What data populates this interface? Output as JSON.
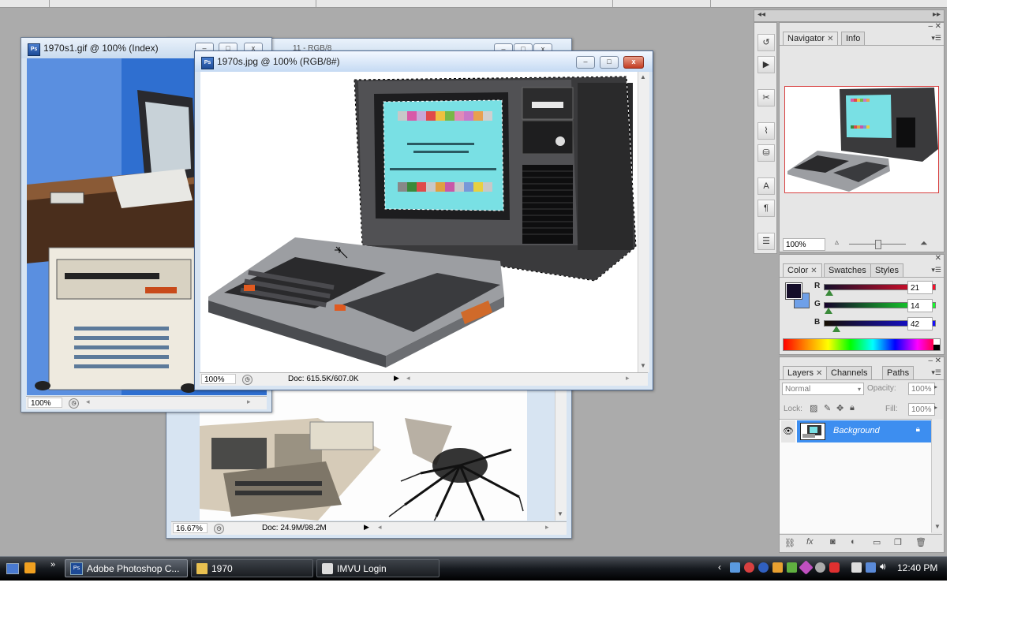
{
  "documents": {
    "back": {
      "title": "11 - RGB/8",
      "zoom": "16.67%",
      "doc_info": "Doc: 24.9M/98.2M"
    },
    "gif": {
      "title": "1970s1.gif @ 100% (Index)",
      "zoom": "100%"
    },
    "jpg": {
      "title": "1970s.jpg @ 100% (RGB/8#)",
      "zoom": "100%",
      "doc_info": "Doc: 615.5K/607.0K"
    }
  },
  "panels": {
    "navigator": {
      "tabs": [
        "Navigator",
        "Info"
      ],
      "zoom": "100%"
    },
    "color": {
      "tabs": [
        "Color",
        "Swatches",
        "Styles"
      ],
      "foreground": "#150e2a",
      "background": "#6fa0e8",
      "channels": [
        {
          "label": "R",
          "value": "21"
        },
        {
          "label": "G",
          "value": "14"
        },
        {
          "label": "B",
          "value": "42"
        }
      ]
    },
    "layers": {
      "tabs": [
        "Layers",
        "Channels",
        "Paths"
      ],
      "blend_mode": "Normal",
      "opacity_label": "Opacity:",
      "opacity_value": "100%",
      "lock_label": "Lock:",
      "fill_label": "Fill:",
      "fill_value": "100%",
      "layer_name": "Background"
    }
  },
  "taskbar": {
    "buttons": [
      {
        "label": "Adobe Photoshop C...",
        "icon": "photoshop-icon"
      },
      {
        "label": "1970",
        "icon": "folder-icon"
      },
      {
        "label": "IMVU Login",
        "icon": "imvu-icon"
      }
    ],
    "clock": "12:40 PM"
  },
  "colors": {
    "selection_blue": "#3d8ef0",
    "panel_gray": "#e6e6e6",
    "workspace_gray": "#ababab"
  }
}
